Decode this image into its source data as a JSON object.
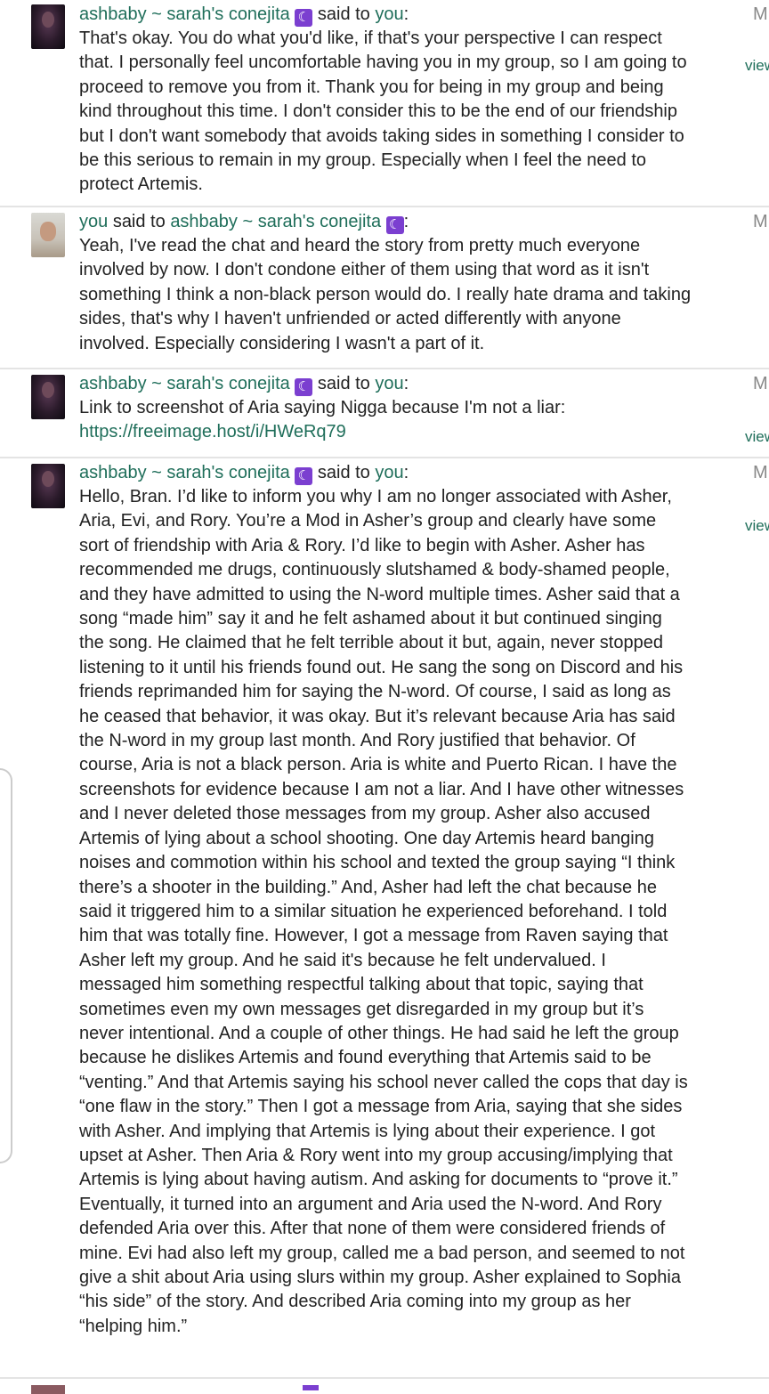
{
  "messages": [
    {
      "sender": "ashbaby ~ sarah's conejita",
      "moon_glyph": "☾",
      "verb": "said to",
      "recipient": "you",
      "colon": ":",
      "body": "That's okay. You do what you'd like, if that's your perspective I can respect that. I personally feel uncomfortable having you in my group, so I am going to proceed to remove you from it. Thank you for being in my group and being kind throughout this time. I don't consider this to be the end of our friendship but I don't want somebody that avoids taking sides in something I consider to be this serious to remain in my group. Especially when I feel the need to protect Artemis.",
      "side_label": "M",
      "side_link": "view"
    },
    {
      "sender": "you",
      "verb": "said to",
      "recipient": "ashbaby ~ sarah's conejita",
      "moon_glyph": "☾",
      "colon": ":",
      "body": "Yeah, I've read the chat and heard the story from pretty much everyone involved by now. I don't condone either of them using that word as it isn't something I think a non-black person would do. I really hate drama and taking sides, that's why I haven't unfriended or acted differently with anyone involved. Especially considering I wasn't a part of it.",
      "side_label": "M"
    },
    {
      "sender": "ashbaby ~ sarah's conejita",
      "moon_glyph": "☾",
      "verb": "said to",
      "recipient": "you",
      "colon": ":",
      "body": "Link to screenshot of Aria saying Nigga because I'm not a liar:",
      "link": "https://freeimage.host/i/HWeRq79",
      "side_label": "M",
      "side_link": "view"
    },
    {
      "sender": "ashbaby ~ sarah's conejita",
      "moon_glyph": "☾",
      "verb": "said to",
      "recipient": "you",
      "colon": ":",
      "body": "Hello, Bran. I’d like to inform you why I am no longer associated with Asher, Aria, Evi, and Rory. You’re a Mod in Asher’s group and clearly have some sort of friendship with Aria & Rory. I’d like to begin with Asher. Asher has recommended me drugs, continuously slutshamed & body-shamed people, and they have admitted to using the N-word multiple times. Asher said that a song “made him” say it and he felt ashamed about it but continued singing the song. He claimed that he felt terrible about it but, again, never stopped listening to it until his friends found out. He sang the song on Discord and his friends reprimanded him for saying the N-word. Of course, I said as long as he ceased that behavior, it was okay. But it’s relevant because Aria has said the N-word in my group last month. And Rory justified that behavior. Of course, Aria is not a black person. Aria is white and Puerto Rican. I have the screenshots for evidence because I am not a liar. And I have other witnesses and I never deleted those messages from my group. Asher also accused Artemis of lying about a school shooting. One day Artemis heard banging noises and commotion within his school and texted the group saying “I think there’s a shooter in the building.” And, Asher had left the chat because he said it triggered him to a similar situation he experienced beforehand. I told him that was totally fine. However, I got a message from Raven saying that Asher left my group. And he said it's because he felt undervalued. I messaged him something respectful talking about that topic, saying that sometimes even my own messages get disregarded in my group but it’s never intentional. And a couple of other things. He had said he left the group because he dislikes Artemis and found everything that Artemis said to be “venting.” And that Artemis saying his school never called the cops that day is “one flaw in the story.” Then I got a message from Aria, saying that she sides with Asher. And implying that Artemis is lying about their experience. I got upset at Asher. Then Aria & Rory went into my group accusing/implying that Artemis is lying about having autism. And asking for documents to “prove it.” Eventually, it turned into an argument and Aria used the N-word. And Rory defended Aria over this. After that none of them were considered friends of mine. Evi had also left my group, called me a bad person, and seemed to not give a shit about Aria using slurs within my group. Asher explained to Sophia “his side” of the story. And described Aria coming into my group as her “helping him.”",
      "side_label": "M",
      "side_link": "view"
    }
  ]
}
